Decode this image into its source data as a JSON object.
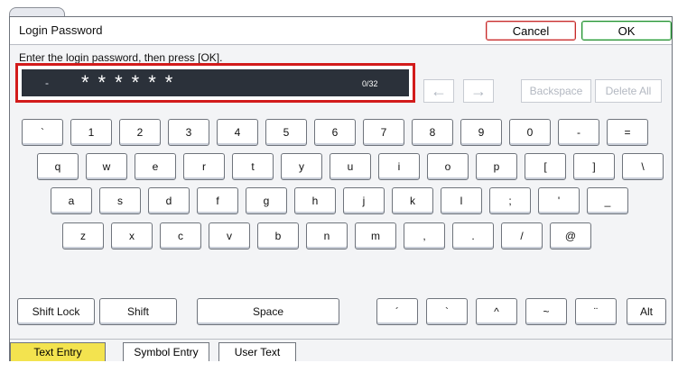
{
  "dialog": {
    "title": "Login Password",
    "cancel_label": "Cancel",
    "ok_label": "OK",
    "instruction": "Enter the login password, then press [OK]."
  },
  "field": {
    "dash": "-",
    "masked_value": "******",
    "counter": "0/32"
  },
  "nav": {
    "left_icon": "arrow-left-icon",
    "right_icon": "arrow-right-icon",
    "backspace_label": "Backspace",
    "delete_all_label": "Delete All"
  },
  "keyboard": {
    "row1": [
      "`",
      "1",
      "2",
      "3",
      "4",
      "5",
      "6",
      "7",
      "8",
      "9",
      "0",
      "-",
      "="
    ],
    "row2": [
      "q",
      "w",
      "e",
      "r",
      "t",
      "y",
      "u",
      "i",
      "o",
      "p",
      "[",
      "]",
      "\\"
    ],
    "row3": [
      "a",
      "s",
      "d",
      "f",
      "g",
      "h",
      "j",
      "k",
      "l",
      ";",
      "'",
      "_"
    ],
    "row4": [
      "z",
      "x",
      "c",
      "v",
      "b",
      "n",
      "m",
      ",",
      ".",
      "/",
      "@"
    ],
    "bottom": {
      "shift_lock": "Shift Lock",
      "shift": "Shift",
      "space": "Space",
      "accents": [
        "´",
        "`",
        "^",
        "~",
        "¨"
      ],
      "alt": "Alt"
    }
  },
  "tabs": {
    "text_entry": "Text Entry",
    "symbol_entry": "Symbol Entry",
    "user_text": "User Text"
  }
}
